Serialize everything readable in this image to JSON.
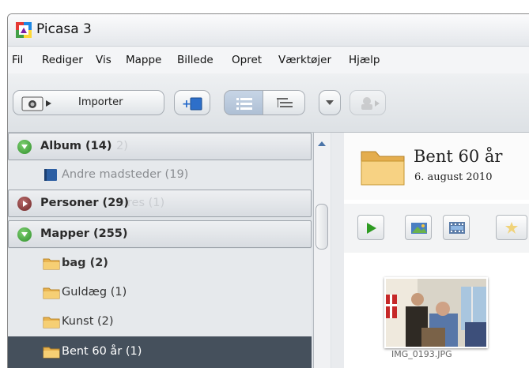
{
  "window": {
    "title": "Picasa 3"
  },
  "menu": [
    "Fil",
    "Rediger",
    "Vis",
    "Mappe",
    "Billede",
    "Opret",
    "Værktøjer",
    "Hjælp"
  ],
  "toolbar": {
    "import_label": "Importer"
  },
  "sidebar": {
    "album_header": "Album (14)",
    "album_ghost": "2)",
    "album_item": "Andre madsteder (19)",
    "people_header": "Personer (29)",
    "people_ghost": "tures (1)",
    "folders_header": "Mapper (255)",
    "folders": [
      {
        "label": "bag (2)",
        "bold": true
      },
      {
        "label": "Guldæg (1)",
        "bold": false
      },
      {
        "label": "Kunst (2)",
        "bold": false
      },
      {
        "label": "Bent 60 år (1)",
        "selected": true
      }
    ]
  },
  "album": {
    "title": "Bent 60 år",
    "date": "6. august 2010"
  },
  "photo": {
    "caption": "IMG_0193.JPG"
  },
  "colors": {
    "selected_row": "#45505c",
    "play_green": "#2e9b22"
  }
}
